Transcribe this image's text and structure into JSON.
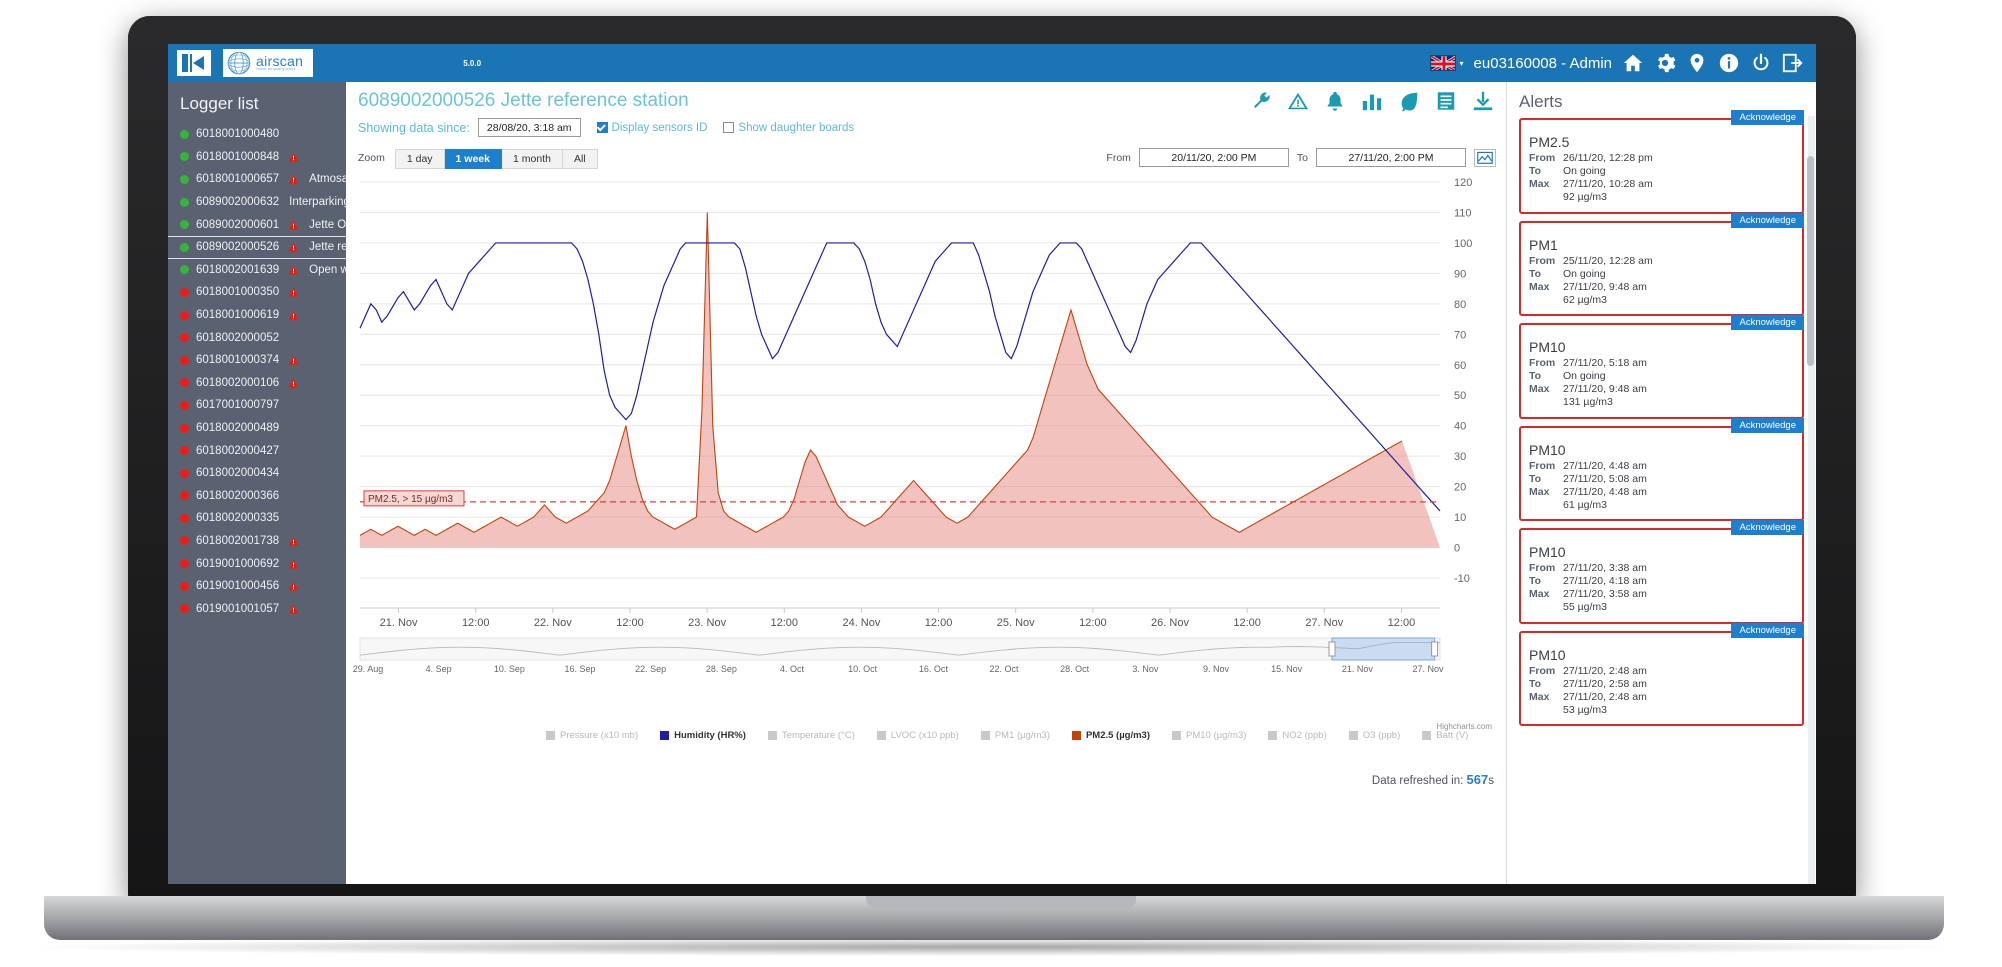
{
  "topbar": {
    "version": "5.0.0",
    "brand_name": "airscan",
    "brand_tagline": "indoor air quality check",
    "username": "eu03160008 - Admin",
    "icons": [
      "home-icon",
      "gear-icon",
      "location-pin-icon",
      "info-icon",
      "power-icon",
      "logout-icon"
    ]
  },
  "sidebar": {
    "title": "Logger list",
    "items": [
      {
        "id": "6018001000480",
        "name": "",
        "status": "green",
        "warn": false
      },
      {
        "id": "6018001000848",
        "name": "",
        "status": "green",
        "warn": true
      },
      {
        "id": "6018001000657",
        "name": "Atmosafe test",
        "status": "green",
        "warn": true
      },
      {
        "id": "6089002000632",
        "name": "Interparking reference",
        "status": "green",
        "warn": false
      },
      {
        "id": "6089002000601",
        "name": "Jette Outdoor",
        "status": "green",
        "warn": true
      },
      {
        "id": "6089002000526",
        "name": "Jette reference station",
        "status": "green",
        "warn": true,
        "selected": true
      },
      {
        "id": "6018002001639",
        "name": "Open workspace",
        "status": "green",
        "warn": true
      },
      {
        "id": "6018001000350",
        "name": "",
        "status": "red",
        "warn": true
      },
      {
        "id": "6018001000619",
        "name": "",
        "status": "red",
        "warn": true
      },
      {
        "id": "6018002000052",
        "name": "",
        "status": "red",
        "warn": false
      },
      {
        "id": "6018001000374",
        "name": "",
        "status": "red",
        "warn": true
      },
      {
        "id": "6018002000106",
        "name": "",
        "status": "red",
        "warn": true
      },
      {
        "id": "6017001000797",
        "name": "",
        "status": "red",
        "warn": false
      },
      {
        "id": "6018002000489",
        "name": "",
        "status": "red",
        "warn": false
      },
      {
        "id": "6018002000427",
        "name": "",
        "status": "red",
        "warn": false
      },
      {
        "id": "6018002000434",
        "name": "",
        "status": "red",
        "warn": false
      },
      {
        "id": "6018002000366",
        "name": "",
        "status": "red",
        "warn": false
      },
      {
        "id": "6018002000335",
        "name": "",
        "status": "red",
        "warn": false
      },
      {
        "id": "6018002001738",
        "name": "",
        "status": "red",
        "warn": true
      },
      {
        "id": "6019001000692",
        "name": "",
        "status": "red",
        "warn": true
      },
      {
        "id": "6019001000456",
        "name": "",
        "status": "red",
        "warn": true
      },
      {
        "id": "6019001001057",
        "name": "",
        "status": "red",
        "warn": true
      }
    ]
  },
  "main": {
    "station_title": "6089002000526 Jette reference station",
    "since_label": "Showing data since:",
    "since_value": "28/08/20, 3:18 am",
    "display_sensors_id_label": "Display sensors ID",
    "display_sensors_id_checked": true,
    "show_daughter_boards_label": "Show daughter boards",
    "show_daughter_boards_checked": false,
    "zoom_label": "Zoom",
    "zoom_options": [
      "1 day",
      "1 week",
      "1 month",
      "All"
    ],
    "zoom_active": "1 week",
    "from_label": "From",
    "from_value": "20/11/20, 2:00 PM",
    "to_label": "To",
    "to_value": "27/11/20, 2:00 PM",
    "header_icons": [
      "wrench-icon",
      "warning-triangle-icon",
      "bell-icon",
      "bar-chart-icon",
      "leaf-icon",
      "document-icon",
      "download-icon"
    ],
    "credit": "Highcharts.com",
    "refresh_label": "Data refreshed in:",
    "refresh_seconds": "567",
    "refresh_unit": "s"
  },
  "chart_data": {
    "type": "line",
    "title": "",
    "xlabel": "",
    "ylabel": "",
    "ylim": [
      -10,
      120
    ],
    "yticks": [
      -10,
      0,
      10,
      20,
      30,
      40,
      50,
      60,
      70,
      80,
      90,
      100,
      110,
      120
    ],
    "grid": true,
    "legend_position": "bottom",
    "xticks": [
      "21. Nov",
      "12:00",
      "22. Nov",
      "12:00",
      "23. Nov",
      "12:00",
      "24. Nov",
      "12:00",
      "25. Nov",
      "12:00",
      "26. Nov",
      "12:00",
      "27. Nov",
      "12:00"
    ],
    "navigator_ticks": [
      "29. Aug",
      "4. Sep",
      "10. Sep",
      "16. Sep",
      "22. Sep",
      "28. Sep",
      "4. Oct",
      "10. Oct",
      "16. Oct",
      "22. Oct",
      "28. Oct",
      "3. Nov",
      "9. Nov",
      "15. Nov",
      "21. Nov",
      "27. Nov"
    ],
    "navigator_selection": [
      "21. Nov",
      "27. Nov"
    ],
    "threshold": {
      "label": "PM2.5, > 15 µg/m3",
      "value": 15,
      "color": "#d94040"
    },
    "series": [
      {
        "name": "Pressure (x10 mb)",
        "color": "#c9c9c9",
        "visible": false,
        "values": []
      },
      {
        "name": "Humidity (HR%)",
        "color": "#1f1f9e",
        "visible": true,
        "values": [
          72,
          76,
          80,
          78,
          74,
          76,
          79,
          82,
          84,
          81,
          78,
          80,
          83,
          86,
          88,
          84,
          80,
          78,
          82,
          86,
          90,
          92,
          94,
          96,
          98,
          100,
          100,
          100,
          100,
          100,
          100,
          100,
          100,
          100,
          100,
          100,
          100,
          100,
          100,
          100,
          98,
          94,
          88,
          80,
          70,
          58,
          50,
          46,
          44,
          42,
          44,
          50,
          58,
          66,
          74,
          80,
          86,
          90,
          94,
          98,
          100,
          100,
          100,
          100,
          100,
          100,
          100,
          100,
          100,
          100,
          98,
          92,
          84,
          76,
          70,
          66,
          62,
          64,
          68,
          72,
          76,
          80,
          84,
          88,
          92,
          96,
          100,
          100,
          100,
          100,
          100,
          100,
          98,
          94,
          88,
          80,
          74,
          70,
          68,
          66,
          70,
          74,
          78,
          82,
          86,
          90,
          94,
          96,
          98,
          100,
          100,
          100,
          100,
          100,
          96,
          90,
          84,
          76,
          70,
          64,
          62,
          66,
          72,
          78,
          84,
          88,
          92,
          96,
          98,
          100,
          100,
          100,
          100,
          98,
          94,
          90,
          86,
          82,
          78,
          74,
          70,
          66,
          64,
          68,
          74,
          80,
          84,
          88,
          90,
          92,
          94,
          96,
          98,
          100,
          100,
          100,
          98,
          96,
          94,
          92,
          90,
          88,
          86,
          84,
          82,
          80,
          78,
          76,
          74,
          72,
          70,
          68,
          66,
          64,
          62,
          60,
          58,
          56,
          54,
          52,
          50,
          48,
          46,
          44,
          42,
          40,
          38,
          36,
          34,
          32,
          30,
          28,
          26,
          24,
          22,
          20,
          18,
          16,
          14,
          12
        ]
      },
      {
        "name": "Temperature (°C)",
        "color": "#c9c9c9",
        "visible": false,
        "values": []
      },
      {
        "name": "LVOC (x10 ppb)",
        "color": "#c9c9c9",
        "visible": false,
        "values": []
      },
      {
        "name": "PM1 (µg/m3)",
        "color": "#c9c9c9",
        "visible": false,
        "values": []
      },
      {
        "name": "PM2.5 (µg/m3)",
        "color": "#c1440e",
        "visible": true,
        "values": [
          4,
          5,
          6,
          5,
          4,
          5,
          6,
          7,
          6,
          5,
          4,
          5,
          6,
          5,
          4,
          5,
          6,
          7,
          8,
          7,
          6,
          5,
          6,
          7,
          8,
          9,
          10,
          9,
          8,
          7,
          8,
          9,
          10,
          12,
          14,
          12,
          10,
          9,
          8,
          9,
          10,
          11,
          12,
          14,
          16,
          18,
          22,
          28,
          34,
          40,
          30,
          22,
          16,
          12,
          10,
          9,
          8,
          7,
          6,
          7,
          8,
          9,
          10,
          45,
          110,
          40,
          18,
          12,
          10,
          9,
          8,
          7,
          6,
          5,
          6,
          7,
          8,
          9,
          10,
          12,
          16,
          22,
          28,
          32,
          30,
          26,
          22,
          18,
          14,
          12,
          10,
          9,
          8,
          7,
          8,
          9,
          10,
          12,
          14,
          16,
          18,
          20,
          22,
          20,
          18,
          16,
          14,
          12,
          10,
          9,
          8,
          9,
          10,
          12,
          14,
          16,
          18,
          20,
          22,
          24,
          26,
          28,
          30,
          32,
          36,
          42,
          48,
          54,
          60,
          66,
          72,
          78,
          72,
          66,
          60,
          56,
          52,
          50,
          48,
          46,
          44,
          42,
          40,
          38,
          36,
          34,
          32,
          30,
          28,
          26,
          24,
          22,
          20,
          18,
          16,
          14,
          12,
          10,
          9,
          8,
          7,
          6,
          5,
          6,
          7,
          8,
          9,
          10,
          11,
          12,
          13,
          14,
          15,
          16,
          17,
          18,
          19,
          20,
          21,
          22,
          23,
          24,
          25,
          26,
          27,
          28,
          29,
          30,
          31,
          32,
          33,
          34,
          35
        ]
      },
      {
        "name": "PM10 (µg/m3)",
        "color": "#c9c9c9",
        "visible": false,
        "values": []
      },
      {
        "name": "NO2 (ppb)",
        "color": "#c9c9c9",
        "visible": false,
        "values": []
      },
      {
        "name": "O3 (ppb)",
        "color": "#c9c9c9",
        "visible": false,
        "values": []
      },
      {
        "name": "Batt (V)",
        "color": "#c9c9c9",
        "visible": false,
        "values": []
      }
    ]
  },
  "alerts": {
    "title": "Alerts",
    "acknowledge_label": "Acknowledge",
    "from_label": "From",
    "to_label": "To",
    "max_label": "Max",
    "items": [
      {
        "pollutant": "PM2.5",
        "from": "26/11/20, 12:28 pm",
        "to": "On going",
        "max_time": "27/11/20, 10:28 am",
        "max_value": "92 µg/m3"
      },
      {
        "pollutant": "PM1",
        "from": "25/11/20, 12:28 am",
        "to": "On going",
        "max_time": "27/11/20, 9:48 am",
        "max_value": "62 µg/m3"
      },
      {
        "pollutant": "PM10",
        "from": "27/11/20, 5:18 am",
        "to": "On going",
        "max_time": "27/11/20, 9:48 am",
        "max_value": "131 µg/m3"
      },
      {
        "pollutant": "PM10",
        "from": "27/11/20, 4:48 am",
        "to": "27/11/20, 5:08 am",
        "max_time": "27/11/20, 4:48 am",
        "max_value": "61 µg/m3"
      },
      {
        "pollutant": "PM10",
        "from": "27/11/20, 3:38 am",
        "to": "27/11/20, 4:18 am",
        "max_time": "27/11/20, 3:58 am",
        "max_value": "55 µg/m3"
      },
      {
        "pollutant": "PM10",
        "from": "27/11/20, 2:48 am",
        "to": "27/11/20, 2:58 am",
        "max_time": "27/11/20, 2:48 am",
        "max_value": "53 µg/m3"
      }
    ]
  }
}
